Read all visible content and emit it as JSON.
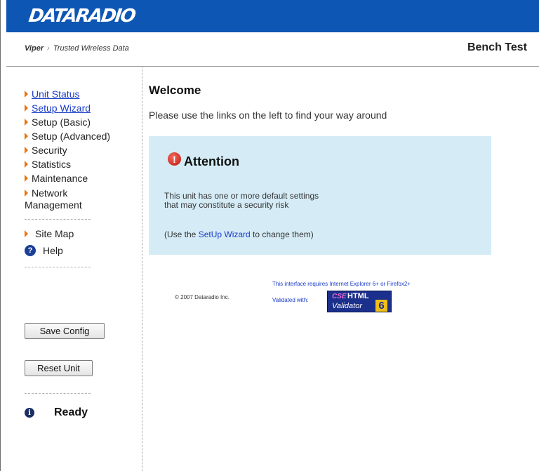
{
  "header": {
    "logo_text": "DATARADIO",
    "brand_color": "#0d56b4"
  },
  "breadcrumb": {
    "root": "Viper",
    "separator": "›",
    "current": "Trusted Wireless Data",
    "device_name": "Bench Test"
  },
  "sidebar": {
    "items": [
      {
        "label": "Unit Status",
        "link": true
      },
      {
        "label": "Setup Wizard",
        "link": true
      },
      {
        "label": "Setup (Basic)",
        "link": false
      },
      {
        "label": "Setup (Advanced)",
        "link": false
      },
      {
        "label": "Security",
        "link": false
      },
      {
        "label": "Statistics",
        "link": false
      },
      {
        "label": "Maintenance",
        "link": false
      },
      {
        "label": "Network Management",
        "link": false
      }
    ],
    "site_map": "Site Map",
    "help": "Help",
    "save_button": "Save Config",
    "reset_button": "Reset Unit",
    "status": "Ready"
  },
  "main": {
    "title": "Welcome",
    "intro": "Please use the links on the left to find your way around",
    "attention": {
      "title": "Attention",
      "body_line1": "This unit has one or more default settings",
      "body_line2": "that may constitute a security risk",
      "action_prefix": "(Use the ",
      "action_link": "SetUp Wizard",
      "action_suffix": " to change them)",
      "box_color": "#d5ecf6"
    },
    "footer": {
      "copyright": "© 2007 Dataradio Inc.",
      "requirement": "This interface requires Internet Explorer 6+ or Firefox2+",
      "validated": "Validated with:",
      "badge_cse": "CSE",
      "badge_html": "HTML",
      "badge_validator": "Validator",
      "badge_version": "6"
    }
  }
}
